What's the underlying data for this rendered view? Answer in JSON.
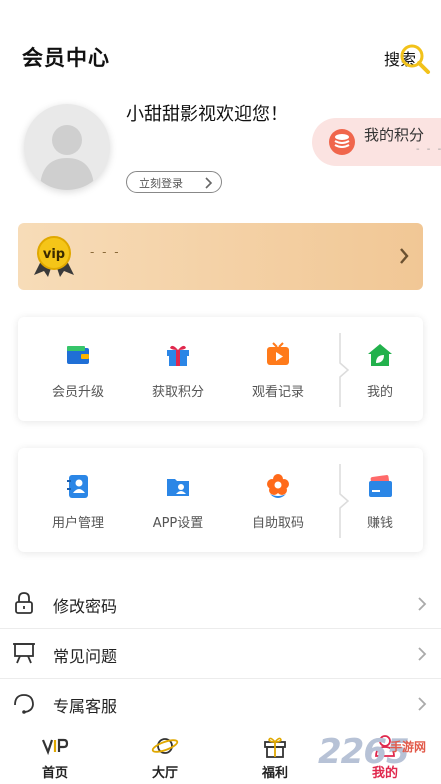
{
  "header": {
    "title": "会员中心",
    "search_label": "搜索"
  },
  "profile": {
    "welcome": "小甜甜影视欢迎您！",
    "login_label": "立刻登录",
    "points_label": "我的积分",
    "points_value": "- - -"
  },
  "vip": {
    "badge_text": "vip",
    "value": "- - -"
  },
  "grid1": [
    {
      "label": "会员升级",
      "icon": "wallet-icon",
      "color": "#1f6fd6"
    },
    {
      "label": "获取积分",
      "icon": "gift-icon",
      "color": "#2b86e6"
    },
    {
      "label": "观看记录",
      "icon": "tv-play-icon",
      "color": "#ff7a1a"
    },
    {
      "label": "我的",
      "icon": "home-leaf-icon",
      "color": "#22b14c"
    }
  ],
  "grid2": [
    {
      "label": "用户管理",
      "icon": "contact-book-icon",
      "color": "#2b86e6"
    },
    {
      "label": "APP设置",
      "icon": "user-folder-icon",
      "color": "#2b86e6"
    },
    {
      "label": "自助取码",
      "icon": "flower-icon",
      "color": "#ff6a1a"
    },
    {
      "label": "赚钱",
      "icon": "card-icon",
      "color": "#2b86e6"
    }
  ],
  "menu": [
    {
      "label": "修改密码",
      "icon": "lock-icon"
    },
    {
      "label": "常见问题",
      "icon": "easel-icon"
    },
    {
      "label": "专属客服",
      "icon": "headset-icon"
    }
  ],
  "nav": [
    {
      "label": "首页",
      "icon": "vip-logo-icon"
    },
    {
      "label": "大厅",
      "icon": "planet-icon"
    },
    {
      "label": "福利",
      "icon": "gift-box-icon"
    },
    {
      "label": "我的",
      "icon": "person-icon",
      "active": true
    }
  ],
  "watermark": {
    "number": "2265",
    "text": "手游网"
  },
  "colors": {
    "accent": "#e0284d",
    "points_bg": "#fbe3e1",
    "vip_gold": "#f1c795"
  }
}
